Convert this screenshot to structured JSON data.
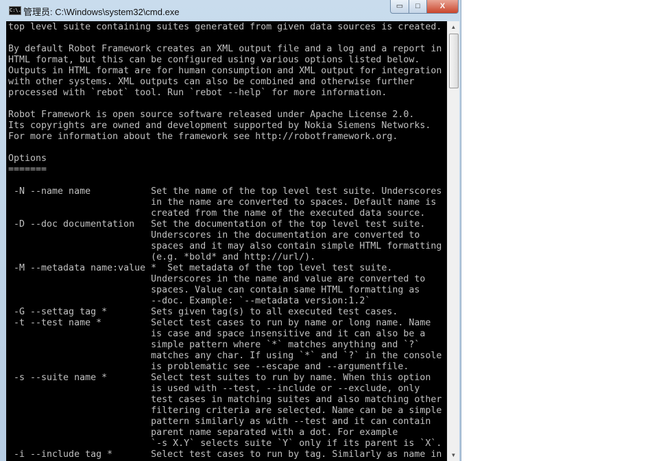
{
  "window": {
    "title": "管理员: C:\\Windows\\system32\\cmd.exe",
    "icon": "cmd-icon",
    "icon_text": "C:\\.",
    "minimize": "▭",
    "maximize": "□",
    "close": "X"
  },
  "console": {
    "lines": [
      "top level suite containing suites generated from given data sources is created.",
      "",
      "By default Robot Framework creates an XML output file and a log and a report in",
      "HTML format, but this can be configured using various options listed below.",
      "Outputs in HTML format are for human consumption and XML output for integration",
      "with other systems. XML outputs can also be combined and otherwise further",
      "processed with `rebot` tool. Run `rebot --help` for more information.",
      "",
      "Robot Framework is open source software released under Apache License 2.0.",
      "Its copyrights are owned and development supported by Nokia Siemens Networks.",
      "For more information about the framework see http://robotframework.org.",
      "",
      "Options",
      "=======",
      "",
      " -N --name name           Set the name of the top level test suite. Underscores",
      "                          in the name are converted to spaces. Default name is",
      "                          created from the name of the executed data source.",
      " -D --doc documentation   Set the documentation of the top level test suite.",
      "                          Underscores in the documentation are converted to",
      "                          spaces and it may also contain simple HTML formatting",
      "                          (e.g. *bold* and http://url/).",
      " -M --metadata name:value *  Set metadata of the top level test suite.",
      "                          Underscores in the name and value are converted to",
      "                          spaces. Value can contain same HTML formatting as",
      "                          --doc. Example: `--metadata version:1.2`",
      " -G --settag tag *        Sets given tag(s) to all executed test cases.",
      " -t --test name *         Select test cases to run by name or long name. Name",
      "                          is case and space insensitive and it can also be a",
      "                          simple pattern where `*` matches anything and `?`",
      "                          matches any char. If using `*` and `?` in the console",
      "                          is problematic see --escape and --argumentfile.",
      " -s --suite name *        Select test suites to run by name. When this option",
      "                          is used with --test, --include or --exclude, only",
      "                          test cases in matching suites and also matching other",
      "                          filtering criteria are selected. Name can be a simple",
      "                          pattern similarly as with --test and it can contain",
      "                          parent name separated with a dot. For example",
      "                          `-s X.Y` selects suite `Y` only if its parent is `X`.",
      " -i --include tag *       Select test cases to run by tag. Similarly as name in"
    ]
  },
  "scrollbar": {
    "up": "▲",
    "down": "▼",
    "position_fraction": 0.0
  }
}
